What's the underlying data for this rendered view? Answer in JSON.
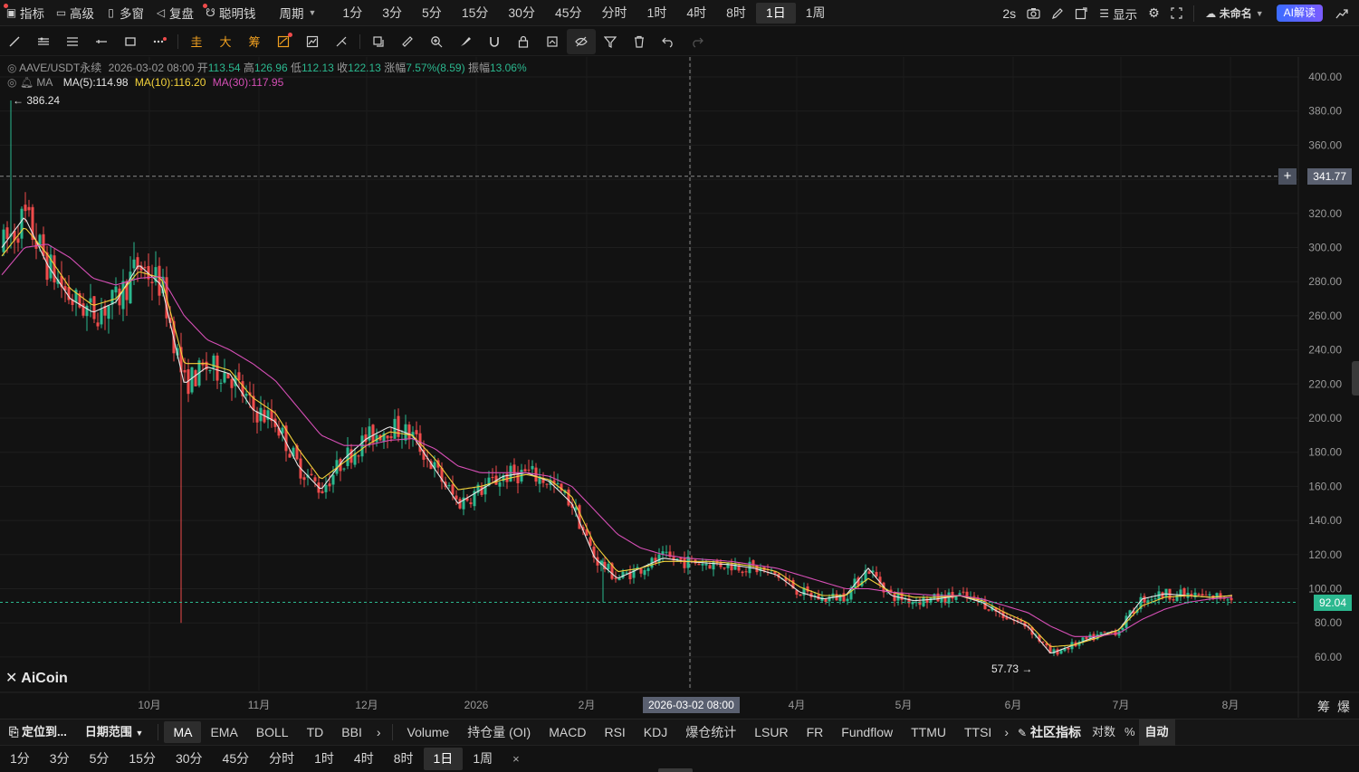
{
  "topbar": {
    "items": [
      {
        "icon": "indicator-icon",
        "glyph": "▣",
        "label": "指标",
        "dot": true
      },
      {
        "icon": "advanced-icon",
        "glyph": "▭",
        "label": "高级",
        "dot": false
      },
      {
        "icon": "multi-window-icon",
        "glyph": "▯",
        "label": "多窗",
        "dot": false
      },
      {
        "icon": "replay-icon",
        "glyph": "◁",
        "label": "复盘",
        "dot": false
      },
      {
        "icon": "smart-money-icon",
        "glyph": "☋",
        "label": "聪明钱",
        "dot": true
      }
    ],
    "period_dropdown": "周期",
    "periods": [
      "1分",
      "3分",
      "5分",
      "15分",
      "30分",
      "45分",
      "分时",
      "1时",
      "4时",
      "8时",
      "1日",
      "1周"
    ],
    "active_period": "1日",
    "refresh": "2s",
    "display_label": "显示",
    "layout_name": "未命名",
    "ai_button": "AI解读"
  },
  "legend": {
    "symbol": "AAVE/USDT永续",
    "date": "2026-03-02 08:00",
    "open_label": "开",
    "open": "113.54",
    "high_label": "高",
    "high": "126.96",
    "low_label": "低",
    "low": "112.13",
    "close_label": "收",
    "close": "122.13",
    "change_label": "涨幅",
    "change": "7.57%(8.59)",
    "amp_label": "振幅",
    "amp": "13.06%",
    "ma_name": "MA",
    "ma5": "MA(5):114.98",
    "ma10": "MA(10):116.20",
    "ma30": "MA(30):117.95"
  },
  "price_axis": {
    "ticks": [
      "400.00",
      "380.00",
      "360.00",
      "340.00",
      "320.00",
      "300.00",
      "280.00",
      "260.00",
      "240.00",
      "220.00",
      "200.00",
      "180.00",
      "160.00",
      "140.00",
      "120.00",
      "100.00",
      "80.00",
      "60.00"
    ],
    "crosshair_price": "341.77",
    "last_price": "92.04",
    "high_marker": "386.24",
    "low_marker": "57.73"
  },
  "time_axis": {
    "labels": [
      "10月",
      "11月",
      "12月",
      "2026",
      "2月",
      "3月",
      "4月",
      "5月",
      "6月",
      "7月",
      "8月"
    ],
    "crosshair_time": "2026-03-02 08:00",
    "right_labels": [
      "筹",
      "爆"
    ]
  },
  "colors": {
    "up": "#2bb88f",
    "down": "#ef4b4b",
    "ma5": "#e6e6e6",
    "ma10": "#f3d23b",
    "ma30": "#d64fb6",
    "last_price_bg": "#2bb88f",
    "crosshair_bg": "#5a6070"
  },
  "watermark": "AiCoin",
  "indicator_tabs": {
    "locate": "定位到...",
    "date_range": "日期范围",
    "main": [
      "MA",
      "EMA",
      "BOLL",
      "TD",
      "BBI"
    ],
    "active_main": "MA",
    "sub": [
      "Volume",
      "持仓量 (OI)",
      "MACD",
      "RSI",
      "KDJ",
      "爆仓统计",
      "LSUR",
      "FR",
      "Fundflow",
      "TTMU",
      "TTSI"
    ],
    "community": "社区指标",
    "log": "对数",
    "percent": "%",
    "auto": "自动"
  },
  "bottom_periods": {
    "items": [
      "1分",
      "3分",
      "5分",
      "15分",
      "30分",
      "45分",
      "分时",
      "1时",
      "4时",
      "8时",
      "1日",
      "1周"
    ],
    "active": "1日",
    "close": "×"
  },
  "chart_data": {
    "type": "candlestick",
    "x_range": [
      "2025-09",
      "2026-08"
    ],
    "ylim": [
      50,
      410
    ],
    "grid": true,
    "series": [
      {
        "name": "MA(5)",
        "values": [
          300,
          318,
          290,
          270,
          262,
          268,
          290,
          278,
          220,
          230,
          226,
          205,
          198,
          172,
          158,
          176,
          188,
          195,
          190,
          170,
          150,
          158,
          166,
          168,
          163,
          150,
          118,
          106,
          112,
          118,
          116,
          115,
          114,
          112,
          108,
          98,
          94,
          96,
          112,
          96,
          93,
          94,
          96,
          92,
          84,
          78,
          62,
          67,
          72,
          76,
          94,
          97,
          96,
          95,
          96
        ]
      },
      {
        "name": "MA(10)",
        "values": [
          295,
          312,
          296,
          276,
          266,
          270,
          286,
          282,
          232,
          232,
          228,
          212,
          203,
          182,
          164,
          174,
          184,
          192,
          190,
          176,
          158,
          160,
          164,
          167,
          164,
          154,
          126,
          110,
          112,
          116,
          116,
          116,
          115,
          113,
          110,
          101,
          96,
          96,
          106,
          98,
          95,
          95,
          96,
          93,
          86,
          80,
          66,
          67,
          71,
          76,
          90,
          95,
          96,
          95,
          96
        ]
      },
      {
        "name": "MA(30)",
        "values": [
          284,
          300,
          302,
          294,
          282,
          278,
          282,
          283,
          260,
          246,
          240,
          232,
          222,
          206,
          190,
          184,
          184,
          187,
          188,
          182,
          172,
          168,
          168,
          168,
          166,
          160,
          146,
          132,
          124,
          120,
          118,
          117,
          116,
          114,
          112,
          108,
          104,
          100,
          100,
          98,
          97,
          96,
          96,
          94,
          90,
          86,
          78,
          72,
          72,
          74,
          82,
          88,
          92,
          94,
          95
        ]
      }
    ],
    "markers": {
      "high": 386.24,
      "low": 57.73,
      "last": 92.04
    }
  }
}
